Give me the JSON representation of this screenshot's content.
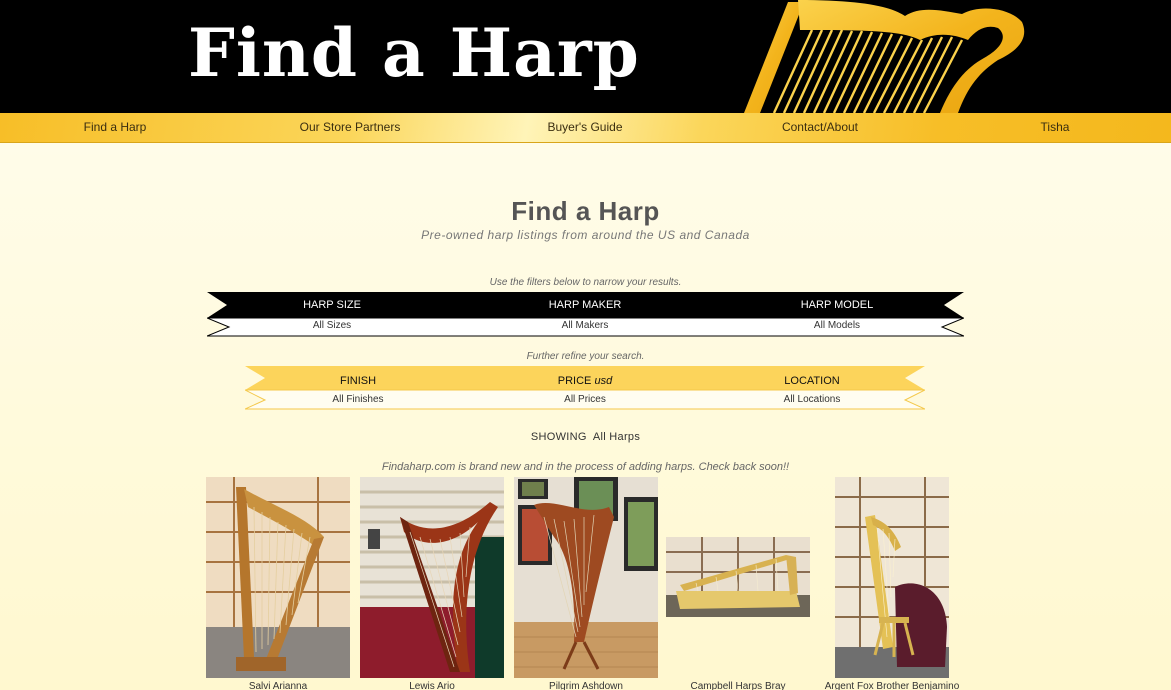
{
  "header": {
    "site_title": "Find a Harp"
  },
  "nav": {
    "items": [
      {
        "label": "Find a Harp"
      },
      {
        "label": "Our Store Partners"
      },
      {
        "label": "Buyer's Guide"
      },
      {
        "label": "Contact/About"
      },
      {
        "label": "Tisha"
      }
    ]
  },
  "main": {
    "title": "Find a Harp",
    "subtitle": "Pre-owned harp listings from around the US and Canada",
    "filters_hint": "Use the filters below to narrow your results.",
    "refine_hint": "Further refine your search.",
    "primary_filters": [
      {
        "heading": "HARP SIZE",
        "value": "All Sizes"
      },
      {
        "heading": "HARP MAKER",
        "value": "All Makers"
      },
      {
        "heading": "HARP MODEL",
        "value": "All Models"
      }
    ],
    "secondary_filters": [
      {
        "heading": "FINISH",
        "heading_suffix": "",
        "value": "All Finishes"
      },
      {
        "heading": "PRICE",
        "heading_suffix": "usd",
        "value": "All Prices"
      },
      {
        "heading": "LOCATION",
        "heading_suffix": "",
        "value": "All Locations"
      }
    ],
    "showing_label": "SHOWING",
    "showing_value": "All Harps",
    "notice": "Findaharp.com is brand new and in the process of adding harps. Check back soon!!",
    "listings": [
      {
        "name": "Salvi Arianna"
      },
      {
        "name": "Lewis Ario"
      },
      {
        "name": "Pilgrim Ashdown"
      },
      {
        "name": "Campbell Harps Bray"
      },
      {
        "name": "Argent Fox Brother Benjamino"
      }
    ]
  },
  "colors": {
    "header_bg": "#000000",
    "nav_gold": "#f7be27",
    "ribbon_yellow": "#fcd45b",
    "page_bg": "#fffae0"
  }
}
